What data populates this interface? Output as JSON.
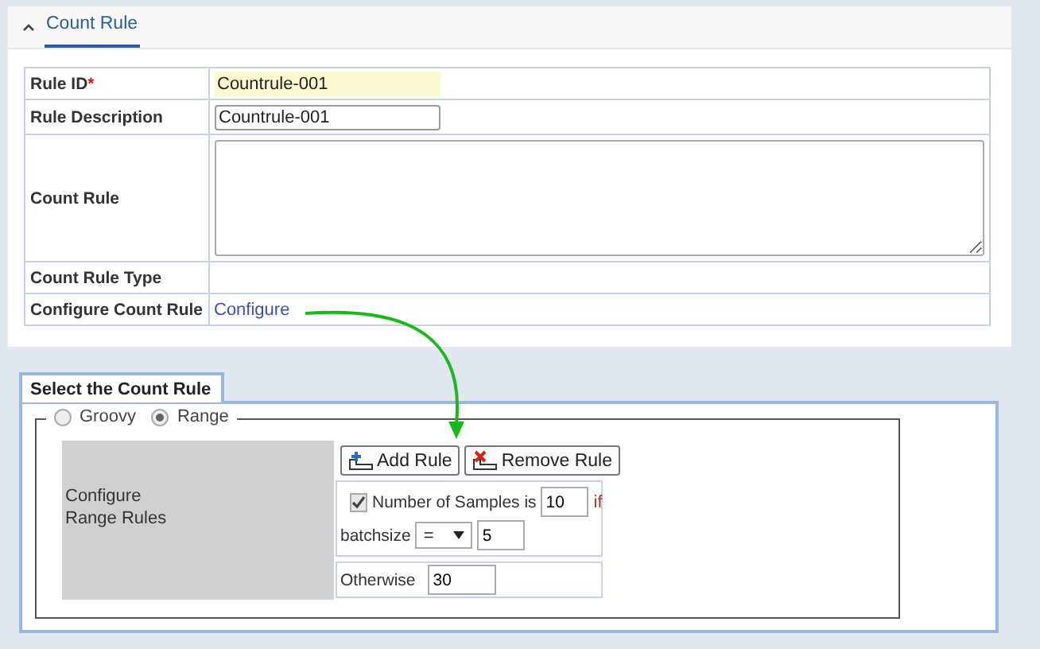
{
  "section": {
    "title": "Count Rule",
    "expanded": true,
    "selected": true
  },
  "form": {
    "required_mark": "*",
    "rows": [
      {
        "kind": "highlight",
        "label": "Rule ID",
        "required": true,
        "value": "Countrule-001"
      },
      {
        "kind": "text",
        "label": "Rule Description",
        "required": false,
        "value": "Countrule-001"
      },
      {
        "kind": "textarea",
        "label": "Count Rule",
        "required": false
      },
      {
        "kind": "empty",
        "label": "Count Rule Type",
        "required": false
      },
      {
        "kind": "link",
        "label": "Configure Count Rule",
        "required": false,
        "link": "Configure"
      }
    ]
  },
  "rule_panel": {
    "tab": "Select the Count Rule",
    "options": [
      {
        "label": "Groovy",
        "selected": false
      },
      {
        "label": "Range",
        "selected": true
      }
    ],
    "config_label": "Configure Range Rules",
    "buttons": [
      {
        "kind": "add",
        "label": "Add Rule"
      },
      {
        "kind": "remove",
        "label": "Remove Rule"
      }
    ],
    "condition": {
      "checked": true,
      "text": "Number of Samples is",
      "count": "10",
      "if_text": "if",
      "field": "batchsize",
      "operator": "=",
      "value": "5"
    },
    "otherwise": {
      "label": "Otherwise",
      "value": "30"
    }
  }
}
